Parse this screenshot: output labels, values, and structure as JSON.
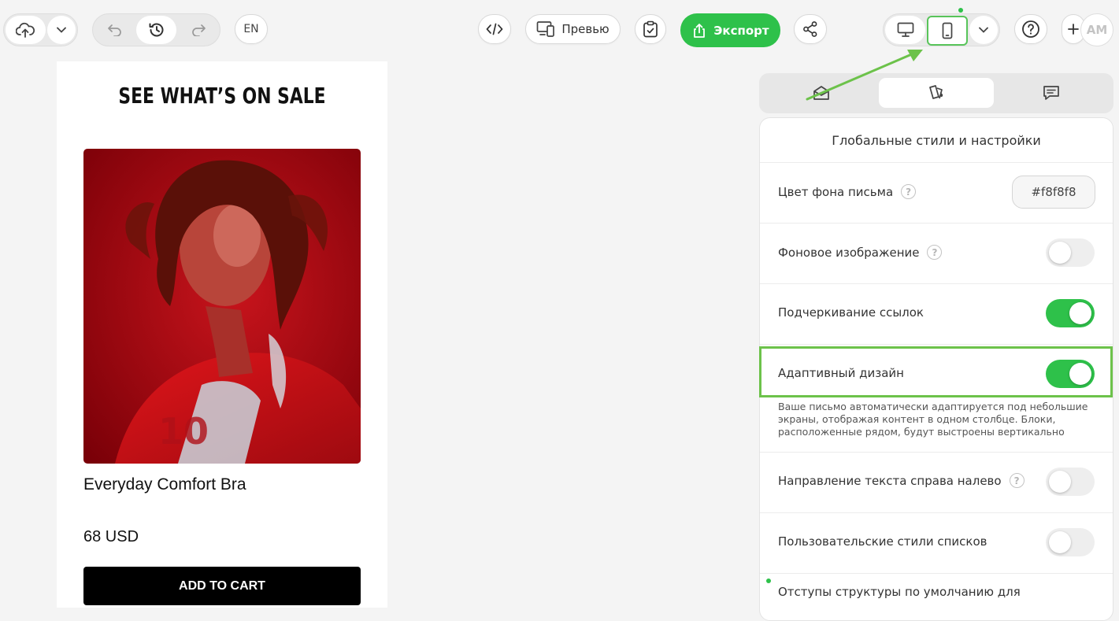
{
  "toolbar": {
    "upload_icon": "cloud-upload-icon",
    "lang_label": "EN",
    "preview_label": "Превью",
    "export_label": "Экспорт",
    "avatar_initials": "AM"
  },
  "canvas": {
    "heading": "SEE WHAT’S ON SALE",
    "product_name": "Everyday Comfort Bra",
    "price": "68 USD",
    "cta_label": "ADD TO CART"
  },
  "panel": {
    "title": "Глобальные стили и настройки",
    "rows": [
      {
        "label": "Цвет фона письма",
        "help": true,
        "value": "#f8f8f8"
      },
      {
        "label": "Фоновое изображение",
        "help": true,
        "toggle": false
      },
      {
        "label": "Подчеркивание ссылок",
        "help": false,
        "toggle": true
      },
      {
        "label": "Адаптивный дизайн",
        "help": false,
        "toggle": true
      },
      {
        "label": "Направление текста справа налево",
        "help": true,
        "toggle": false
      },
      {
        "label": "Пользовательские стили списков",
        "help": false,
        "toggle": false
      },
      {
        "label": "Отступы структуры по умолчанию для",
        "help": true
      }
    ],
    "adaptive_description": "Ваше письмо автоматически адаптируется под небольшие экраны, отображая контент в одном столбце. Блоки, расположенные рядом, будут выстроены вертикально"
  },
  "colors": {
    "accent_green": "#2ec14a",
    "highlight_green": "#6cc24a",
    "background": "#f4f4f4"
  }
}
